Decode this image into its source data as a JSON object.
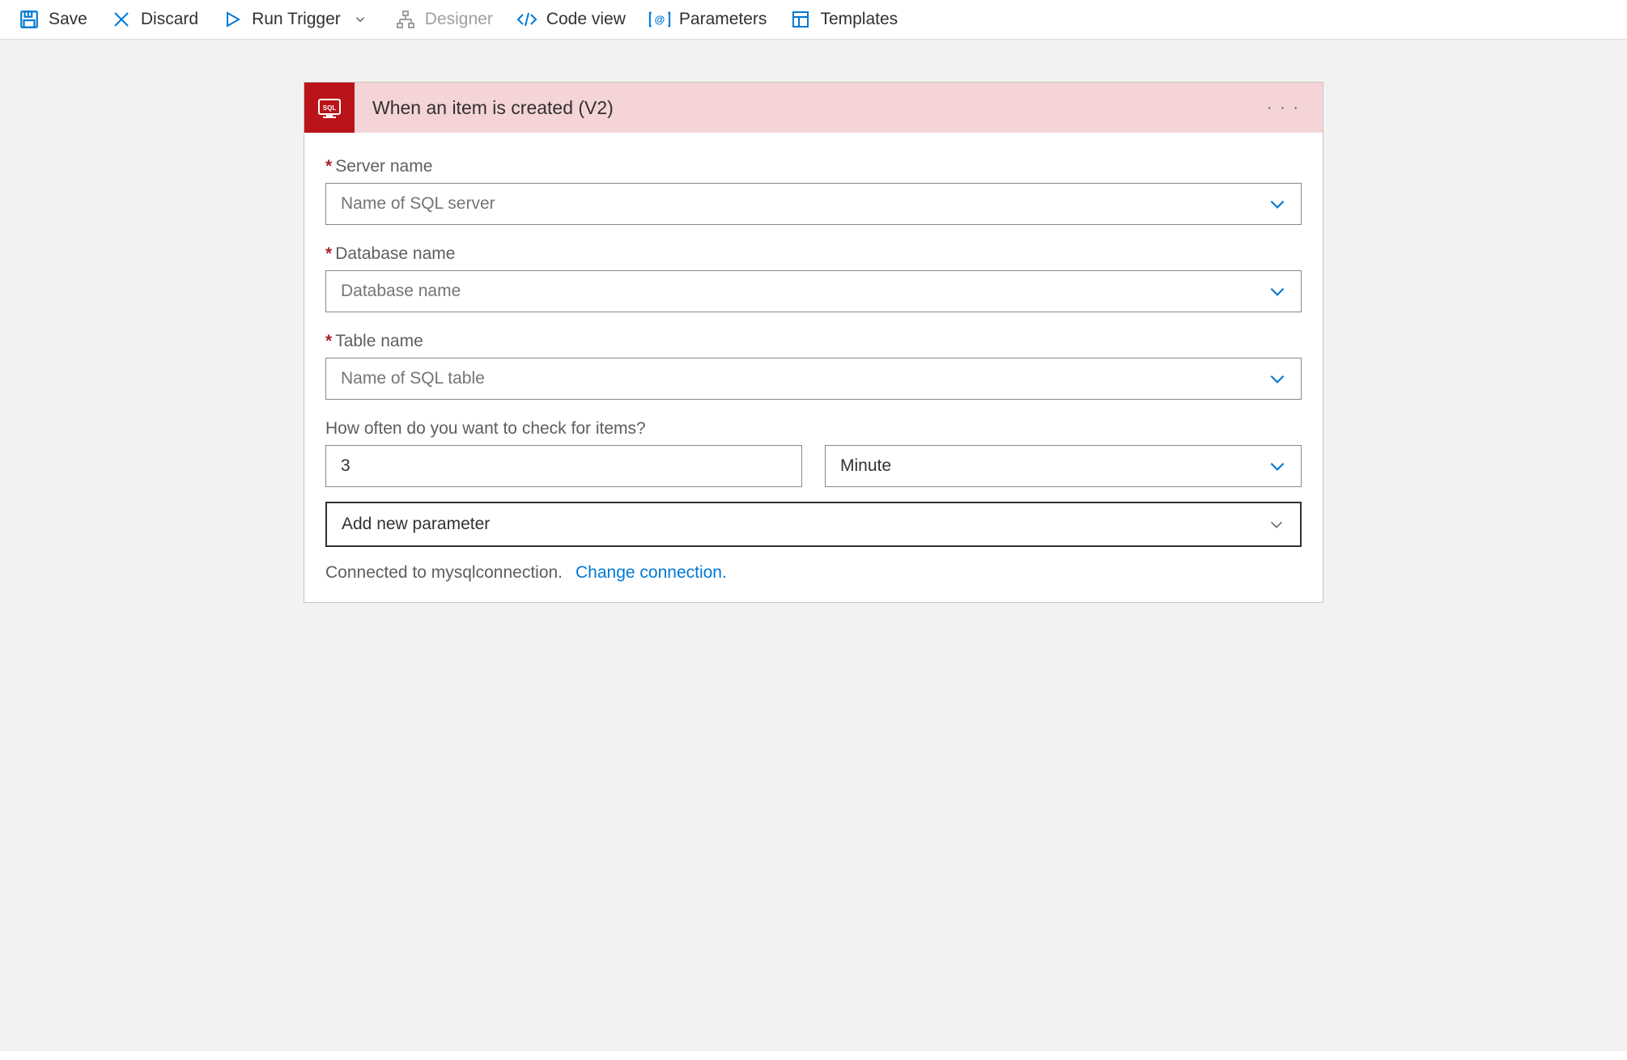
{
  "toolbar": {
    "save": "Save",
    "discard": "Discard",
    "run_trigger": "Run Trigger",
    "designer": "Designer",
    "code_view": "Code view",
    "parameters": "Parameters",
    "templates": "Templates"
  },
  "card": {
    "title": "When an item is created (V2)"
  },
  "fields": {
    "server_label": "Server name",
    "server_placeholder": "Name of SQL server",
    "db_label": "Database name",
    "db_placeholder": "Database name",
    "table_label": "Table name",
    "table_placeholder": "Name of SQL table",
    "freq_label": "How often do you want to check for items?",
    "freq_value": "3",
    "freq_unit": "Minute",
    "add_param": "Add new parameter"
  },
  "footer": {
    "connected": "Connected to mysqlconnection.",
    "change": "Change connection."
  }
}
